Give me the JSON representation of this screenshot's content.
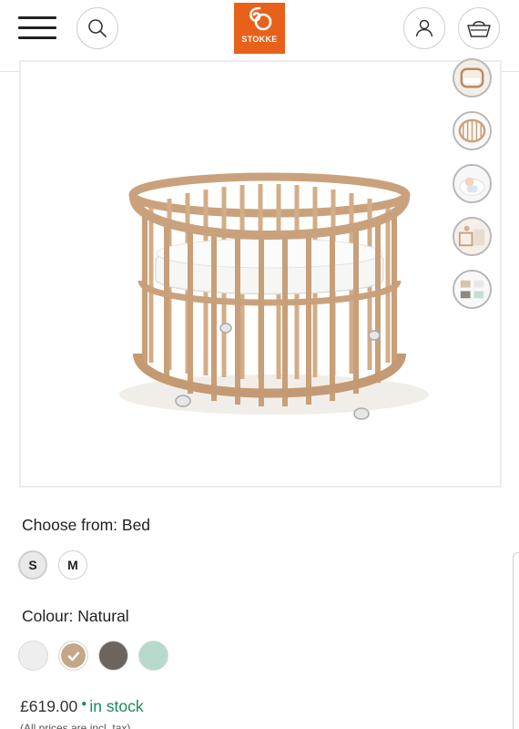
{
  "header": {
    "menu_icon": "hamburger-menu-icon",
    "search_icon": "search-icon",
    "account_icon": "user-icon",
    "cart_icon": "basket-icon",
    "logo_text": "STOKKE",
    "brand_color": "#e8611b"
  },
  "gallery": {
    "main_image": "Oval wooden baby cot in natural beech with white mattress on castor wheels",
    "thumbnails": [
      {
        "alt": "cot lifestyle thumbnail"
      },
      {
        "alt": "cot close-up thumbnail"
      },
      {
        "alt": "baby in cot thumbnail"
      },
      {
        "alt": "nursery room thumbnail"
      },
      {
        "alt": "cot colour variants thumbnail"
      }
    ]
  },
  "options": {
    "choose_label": "Choose from: Bed",
    "sizes": [
      {
        "label": "S",
        "selected": true
      },
      {
        "label": "M",
        "selected": false
      }
    ],
    "colour_label": "Colour: Natural",
    "colours": [
      {
        "name": "White",
        "hex": "#eeeeee",
        "selected": false
      },
      {
        "name": "Natural",
        "hex": "#c4a789",
        "selected": true
      },
      {
        "name": "Hazy Grey",
        "hex": "#6b655e",
        "selected": false
      },
      {
        "name": "Mint Green",
        "hex": "#b7d9cb",
        "selected": false
      }
    ]
  },
  "purchase": {
    "price": "£619.00",
    "stock_status": "in stock",
    "stock_color": "#1a8a5a",
    "tax_note": "(All prices are incl. tax)"
  }
}
